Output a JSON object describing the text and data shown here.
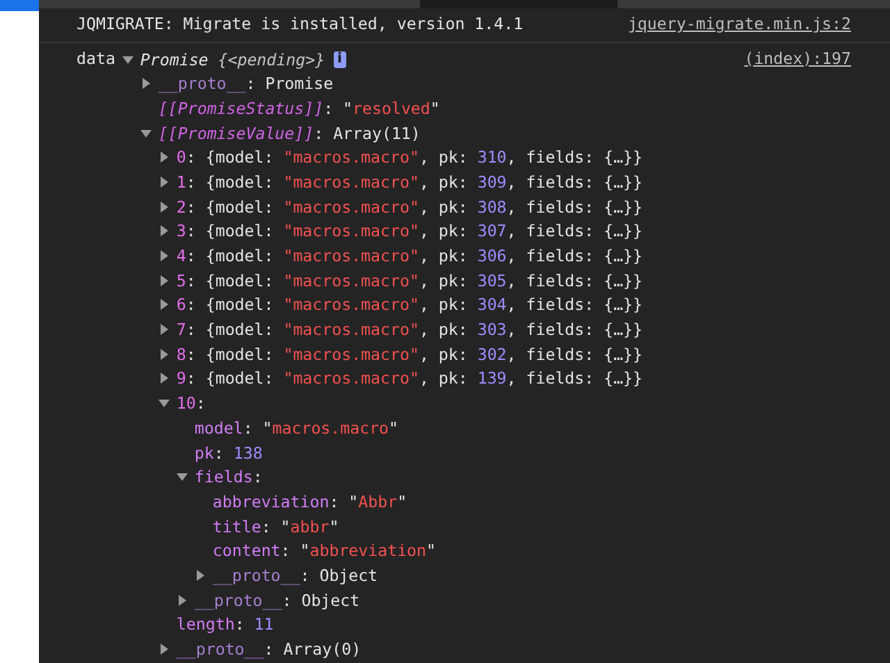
{
  "console": {
    "messages": [
      {
        "kind": "log",
        "text": "JQMIGRATE: Migrate is installed, version 1.4.1",
        "source": "jquery-migrate.min.js:2"
      },
      {
        "kind": "object",
        "label": "data",
        "source": "(index):197",
        "badge": "i",
        "root": {
          "kind": "branch",
          "expanded": true,
          "value": [
            {
              "kind": "italic",
              "text": "Promise "
            },
            {
              "kind": "italic-dim",
              "text": "{<pending>}"
            }
          ],
          "children": [
            {
              "kind": "branch",
              "expanded": false,
              "key": {
                "kind": "proto",
                "text": "__proto__"
              },
              "value": [
                {
                  "kind": "plain",
                  "text": ": Promise"
                }
              ]
            },
            {
              "kind": "leaf",
              "key": {
                "kind": "internal",
                "text": "[[PromiseStatus]]"
              },
              "value": [
                {
                  "kind": "plain",
                  "text": ": \""
                },
                {
                  "kind": "string",
                  "text": "resolved"
                },
                {
                  "kind": "plain",
                  "text": "\""
                }
              ]
            },
            {
              "kind": "branch",
              "expanded": true,
              "key": {
                "kind": "internal",
                "text": "[[PromiseValue]]"
              },
              "value": [
                {
                  "kind": "plain",
                  "text": ": Array(11)"
                }
              ],
              "children": [
                {
                  "kind": "branch",
                  "expanded": false,
                  "key": {
                    "kind": "index",
                    "text": "0"
                  },
                  "value": [
                    {
                      "kind": "plain",
                      "text": ": {model: "
                    },
                    {
                      "kind": "string",
                      "text": "\"macros.macro\""
                    },
                    {
                      "kind": "plain",
                      "text": ", pk: "
                    },
                    {
                      "kind": "number",
                      "text": "310"
                    },
                    {
                      "kind": "plain",
                      "text": ", fields: {…}}"
                    }
                  ]
                },
                {
                  "kind": "branch",
                  "expanded": false,
                  "key": {
                    "kind": "index",
                    "text": "1"
                  },
                  "value": [
                    {
                      "kind": "plain",
                      "text": ": {model: "
                    },
                    {
                      "kind": "string",
                      "text": "\"macros.macro\""
                    },
                    {
                      "kind": "plain",
                      "text": ", pk: "
                    },
                    {
                      "kind": "number",
                      "text": "309"
                    },
                    {
                      "kind": "plain",
                      "text": ", fields: {…}}"
                    }
                  ]
                },
                {
                  "kind": "branch",
                  "expanded": false,
                  "key": {
                    "kind": "index",
                    "text": "2"
                  },
                  "value": [
                    {
                      "kind": "plain",
                      "text": ": {model: "
                    },
                    {
                      "kind": "string",
                      "text": "\"macros.macro\""
                    },
                    {
                      "kind": "plain",
                      "text": ", pk: "
                    },
                    {
                      "kind": "number",
                      "text": "308"
                    },
                    {
                      "kind": "plain",
                      "text": ", fields: {…}}"
                    }
                  ]
                },
                {
                  "kind": "branch",
                  "expanded": false,
                  "key": {
                    "kind": "index",
                    "text": "3"
                  },
                  "value": [
                    {
                      "kind": "plain",
                      "text": ": {model: "
                    },
                    {
                      "kind": "string",
                      "text": "\"macros.macro\""
                    },
                    {
                      "kind": "plain",
                      "text": ", pk: "
                    },
                    {
                      "kind": "number",
                      "text": "307"
                    },
                    {
                      "kind": "plain",
                      "text": ", fields: {…}}"
                    }
                  ]
                },
                {
                  "kind": "branch",
                  "expanded": false,
                  "key": {
                    "kind": "index",
                    "text": "4"
                  },
                  "value": [
                    {
                      "kind": "plain",
                      "text": ": {model: "
                    },
                    {
                      "kind": "string",
                      "text": "\"macros.macro\""
                    },
                    {
                      "kind": "plain",
                      "text": ", pk: "
                    },
                    {
                      "kind": "number",
                      "text": "306"
                    },
                    {
                      "kind": "plain",
                      "text": ", fields: {…}}"
                    }
                  ]
                },
                {
                  "kind": "branch",
                  "expanded": false,
                  "key": {
                    "kind": "index",
                    "text": "5"
                  },
                  "value": [
                    {
                      "kind": "plain",
                      "text": ": {model: "
                    },
                    {
                      "kind": "string",
                      "text": "\"macros.macro\""
                    },
                    {
                      "kind": "plain",
                      "text": ", pk: "
                    },
                    {
                      "kind": "number",
                      "text": "305"
                    },
                    {
                      "kind": "plain",
                      "text": ", fields: {…}}"
                    }
                  ]
                },
                {
                  "kind": "branch",
                  "expanded": false,
                  "key": {
                    "kind": "index",
                    "text": "6"
                  },
                  "value": [
                    {
                      "kind": "plain",
                      "text": ": {model: "
                    },
                    {
                      "kind": "string",
                      "text": "\"macros.macro\""
                    },
                    {
                      "kind": "plain",
                      "text": ", pk: "
                    },
                    {
                      "kind": "number",
                      "text": "304"
                    },
                    {
                      "kind": "plain",
                      "text": ", fields: {…}}"
                    }
                  ]
                },
                {
                  "kind": "branch",
                  "expanded": false,
                  "key": {
                    "kind": "index",
                    "text": "7"
                  },
                  "value": [
                    {
                      "kind": "plain",
                      "text": ": {model: "
                    },
                    {
                      "kind": "string",
                      "text": "\"macros.macro\""
                    },
                    {
                      "kind": "plain",
                      "text": ", pk: "
                    },
                    {
                      "kind": "number",
                      "text": "303"
                    },
                    {
                      "kind": "plain",
                      "text": ", fields: {…}}"
                    }
                  ]
                },
                {
                  "kind": "branch",
                  "expanded": false,
                  "key": {
                    "kind": "index",
                    "text": "8"
                  },
                  "value": [
                    {
                      "kind": "plain",
                      "text": ": {model: "
                    },
                    {
                      "kind": "string",
                      "text": "\"macros.macro\""
                    },
                    {
                      "kind": "plain",
                      "text": ", pk: "
                    },
                    {
                      "kind": "number",
                      "text": "302"
                    },
                    {
                      "kind": "plain",
                      "text": ", fields: {…}}"
                    }
                  ]
                },
                {
                  "kind": "branch",
                  "expanded": false,
                  "key": {
                    "kind": "index",
                    "text": "9"
                  },
                  "value": [
                    {
                      "kind": "plain",
                      "text": ": {model: "
                    },
                    {
                      "kind": "string",
                      "text": "\"macros.macro\""
                    },
                    {
                      "kind": "plain",
                      "text": ", pk: "
                    },
                    {
                      "kind": "number",
                      "text": "139"
                    },
                    {
                      "kind": "plain",
                      "text": ", fields: {…}}"
                    }
                  ]
                },
                {
                  "kind": "branch",
                  "expanded": true,
                  "key": {
                    "kind": "index",
                    "text": "10"
                  },
                  "value": [
                    {
                      "kind": "plain",
                      "text": ":"
                    }
                  ],
                  "children": [
                    {
                      "kind": "leaf",
                      "key": {
                        "kind": "prop",
                        "text": "model"
                      },
                      "value": [
                        {
                          "kind": "plain",
                          "text": ": \""
                        },
                        {
                          "kind": "string",
                          "text": "macros.macro"
                        },
                        {
                          "kind": "plain",
                          "text": "\""
                        }
                      ]
                    },
                    {
                      "kind": "leaf",
                      "key": {
                        "kind": "prop",
                        "text": "pk"
                      },
                      "value": [
                        {
                          "kind": "plain",
                          "text": ": "
                        },
                        {
                          "kind": "number",
                          "text": "138"
                        }
                      ]
                    },
                    {
                      "kind": "branch",
                      "expanded": true,
                      "key": {
                        "kind": "prop",
                        "text": "fields"
                      },
                      "value": [
                        {
                          "kind": "plain",
                          "text": ":"
                        }
                      ],
                      "children": [
                        {
                          "kind": "leaf",
                          "key": {
                            "kind": "prop",
                            "text": "abbreviation"
                          },
                          "value": [
                            {
                              "kind": "plain",
                              "text": ": \""
                            },
                            {
                              "kind": "string",
                              "text": "Abbr"
                            },
                            {
                              "kind": "plain",
                              "text": "\""
                            }
                          ]
                        },
                        {
                          "kind": "leaf",
                          "key": {
                            "kind": "prop",
                            "text": "title"
                          },
                          "value": [
                            {
                              "kind": "plain",
                              "text": ": \""
                            },
                            {
                              "kind": "string",
                              "text": "abbr"
                            },
                            {
                              "kind": "plain",
                              "text": "\""
                            }
                          ]
                        },
                        {
                          "kind": "leaf",
                          "key": {
                            "kind": "prop",
                            "text": "content"
                          },
                          "value": [
                            {
                              "kind": "plain",
                              "text": ": \""
                            },
                            {
                              "kind": "string",
                              "text": "abbreviation"
                            },
                            {
                              "kind": "plain",
                              "text": "\""
                            }
                          ]
                        },
                        {
                          "kind": "branch",
                          "expanded": false,
                          "key": {
                            "kind": "proto",
                            "text": "__proto__"
                          },
                          "value": [
                            {
                              "kind": "plain",
                              "text": ": Object"
                            }
                          ]
                        }
                      ]
                    },
                    {
                      "kind": "branch",
                      "expanded": false,
                      "key": {
                        "kind": "proto",
                        "text": "__proto__"
                      },
                      "value": [
                        {
                          "kind": "plain",
                          "text": ": Object"
                        }
                      ]
                    }
                  ]
                },
                {
                  "kind": "leaf",
                  "key": {
                    "kind": "prop",
                    "text": "length"
                  },
                  "value": [
                    {
                      "kind": "plain",
                      "text": ": "
                    },
                    {
                      "kind": "number",
                      "text": "11"
                    }
                  ]
                },
                {
                  "kind": "branch",
                  "expanded": false,
                  "key": {
                    "kind": "proto",
                    "text": "__proto__"
                  },
                  "value": [
                    {
                      "kind": "plain",
                      "text": ": Array(0)"
                    }
                  ]
                }
              ]
            }
          ]
        }
      }
    ]
  }
}
